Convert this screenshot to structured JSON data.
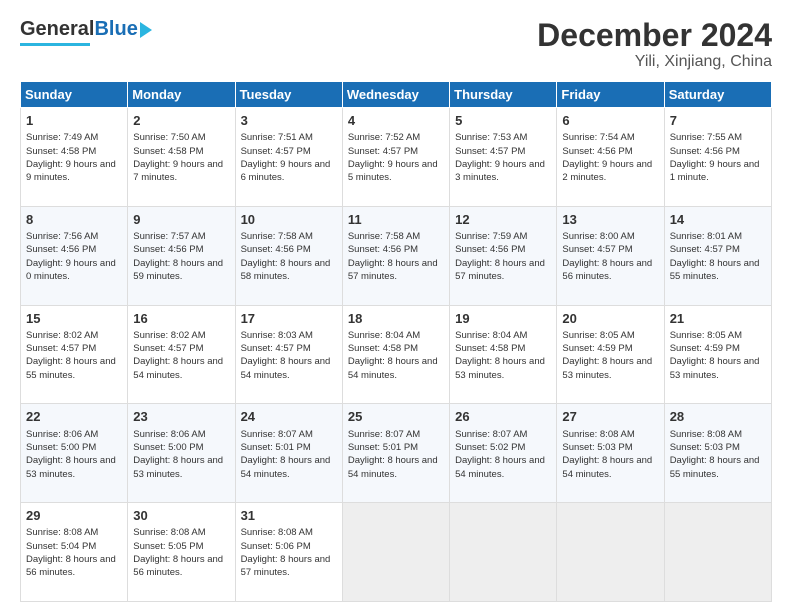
{
  "header": {
    "logo_line1": "General",
    "logo_line2": "Blue",
    "title": "December 2024",
    "subtitle": "Yili, Xinjiang, China"
  },
  "calendar": {
    "days_of_week": [
      "Sunday",
      "Monday",
      "Tuesday",
      "Wednesday",
      "Thursday",
      "Friday",
      "Saturday"
    ],
    "weeks": [
      [
        {
          "day": "1",
          "sunrise": "Sunrise: 7:49 AM",
          "sunset": "Sunset: 4:58 PM",
          "daylight": "Daylight: 9 hours and 9 minutes."
        },
        {
          "day": "2",
          "sunrise": "Sunrise: 7:50 AM",
          "sunset": "Sunset: 4:58 PM",
          "daylight": "Daylight: 9 hours and 7 minutes."
        },
        {
          "day": "3",
          "sunrise": "Sunrise: 7:51 AM",
          "sunset": "Sunset: 4:57 PM",
          "daylight": "Daylight: 9 hours and 6 minutes."
        },
        {
          "day": "4",
          "sunrise": "Sunrise: 7:52 AM",
          "sunset": "Sunset: 4:57 PM",
          "daylight": "Daylight: 9 hours and 5 minutes."
        },
        {
          "day": "5",
          "sunrise": "Sunrise: 7:53 AM",
          "sunset": "Sunset: 4:57 PM",
          "daylight": "Daylight: 9 hours and 3 minutes."
        },
        {
          "day": "6",
          "sunrise": "Sunrise: 7:54 AM",
          "sunset": "Sunset: 4:56 PM",
          "daylight": "Daylight: 9 hours and 2 minutes."
        },
        {
          "day": "7",
          "sunrise": "Sunrise: 7:55 AM",
          "sunset": "Sunset: 4:56 PM",
          "daylight": "Daylight: 9 hours and 1 minute."
        }
      ],
      [
        {
          "day": "8",
          "sunrise": "Sunrise: 7:56 AM",
          "sunset": "Sunset: 4:56 PM",
          "daylight": "Daylight: 9 hours and 0 minutes."
        },
        {
          "day": "9",
          "sunrise": "Sunrise: 7:57 AM",
          "sunset": "Sunset: 4:56 PM",
          "daylight": "Daylight: 8 hours and 59 minutes."
        },
        {
          "day": "10",
          "sunrise": "Sunrise: 7:58 AM",
          "sunset": "Sunset: 4:56 PM",
          "daylight": "Daylight: 8 hours and 58 minutes."
        },
        {
          "day": "11",
          "sunrise": "Sunrise: 7:58 AM",
          "sunset": "Sunset: 4:56 PM",
          "daylight": "Daylight: 8 hours and 57 minutes."
        },
        {
          "day": "12",
          "sunrise": "Sunrise: 7:59 AM",
          "sunset": "Sunset: 4:56 PM",
          "daylight": "Daylight: 8 hours and 57 minutes."
        },
        {
          "day": "13",
          "sunrise": "Sunrise: 8:00 AM",
          "sunset": "Sunset: 4:57 PM",
          "daylight": "Daylight: 8 hours and 56 minutes."
        },
        {
          "day": "14",
          "sunrise": "Sunrise: 8:01 AM",
          "sunset": "Sunset: 4:57 PM",
          "daylight": "Daylight: 8 hours and 55 minutes."
        }
      ],
      [
        {
          "day": "15",
          "sunrise": "Sunrise: 8:02 AM",
          "sunset": "Sunset: 4:57 PM",
          "daylight": "Daylight: 8 hours and 55 minutes."
        },
        {
          "day": "16",
          "sunrise": "Sunrise: 8:02 AM",
          "sunset": "Sunset: 4:57 PM",
          "daylight": "Daylight: 8 hours and 54 minutes."
        },
        {
          "day": "17",
          "sunrise": "Sunrise: 8:03 AM",
          "sunset": "Sunset: 4:57 PM",
          "daylight": "Daylight: 8 hours and 54 minutes."
        },
        {
          "day": "18",
          "sunrise": "Sunrise: 8:04 AM",
          "sunset": "Sunset: 4:58 PM",
          "daylight": "Daylight: 8 hours and 54 minutes."
        },
        {
          "day": "19",
          "sunrise": "Sunrise: 8:04 AM",
          "sunset": "Sunset: 4:58 PM",
          "daylight": "Daylight: 8 hours and 53 minutes."
        },
        {
          "day": "20",
          "sunrise": "Sunrise: 8:05 AM",
          "sunset": "Sunset: 4:59 PM",
          "daylight": "Daylight: 8 hours and 53 minutes."
        },
        {
          "day": "21",
          "sunrise": "Sunrise: 8:05 AM",
          "sunset": "Sunset: 4:59 PM",
          "daylight": "Daylight: 8 hours and 53 minutes."
        }
      ],
      [
        {
          "day": "22",
          "sunrise": "Sunrise: 8:06 AM",
          "sunset": "Sunset: 5:00 PM",
          "daylight": "Daylight: 8 hours and 53 minutes."
        },
        {
          "day": "23",
          "sunrise": "Sunrise: 8:06 AM",
          "sunset": "Sunset: 5:00 PM",
          "daylight": "Daylight: 8 hours and 53 minutes."
        },
        {
          "day": "24",
          "sunrise": "Sunrise: 8:07 AM",
          "sunset": "Sunset: 5:01 PM",
          "daylight": "Daylight: 8 hours and 54 minutes."
        },
        {
          "day": "25",
          "sunrise": "Sunrise: 8:07 AM",
          "sunset": "Sunset: 5:01 PM",
          "daylight": "Daylight: 8 hours and 54 minutes."
        },
        {
          "day": "26",
          "sunrise": "Sunrise: 8:07 AM",
          "sunset": "Sunset: 5:02 PM",
          "daylight": "Daylight: 8 hours and 54 minutes."
        },
        {
          "day": "27",
          "sunrise": "Sunrise: 8:08 AM",
          "sunset": "Sunset: 5:03 PM",
          "daylight": "Daylight: 8 hours and 54 minutes."
        },
        {
          "day": "28",
          "sunrise": "Sunrise: 8:08 AM",
          "sunset": "Sunset: 5:03 PM",
          "daylight": "Daylight: 8 hours and 55 minutes."
        }
      ],
      [
        {
          "day": "29",
          "sunrise": "Sunrise: 8:08 AM",
          "sunset": "Sunset: 5:04 PM",
          "daylight": "Daylight: 8 hours and 56 minutes."
        },
        {
          "day": "30",
          "sunrise": "Sunrise: 8:08 AM",
          "sunset": "Sunset: 5:05 PM",
          "daylight": "Daylight: 8 hours and 56 minutes."
        },
        {
          "day": "31",
          "sunrise": "Sunrise: 8:08 AM",
          "sunset": "Sunset: 5:06 PM",
          "daylight": "Daylight: 8 hours and 57 minutes."
        },
        null,
        null,
        null,
        null
      ]
    ]
  }
}
